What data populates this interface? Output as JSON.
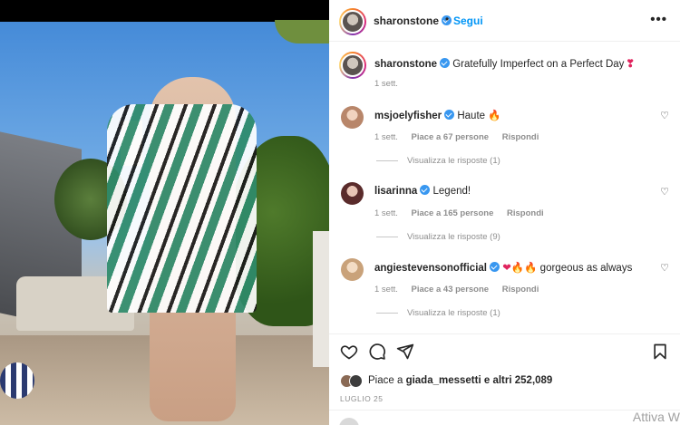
{
  "header": {
    "username": "sharonstone",
    "separator": "•",
    "follow_label": "Segui",
    "more_label": "•••"
  },
  "caption": {
    "username": "sharonstone",
    "text": "Gratefully Imperfect on a Perfect Day",
    "emoji": "❣",
    "time": "1 sett."
  },
  "comments": [
    {
      "username": "msjoelyfisher",
      "text": "Haute",
      "emoji": "🔥",
      "time": "1 sett.",
      "likes": "Piace a 67 persone",
      "reply_label": "Rispondi",
      "view_replies": "Visualizza le risposte (1)",
      "avatar_color": "#b8866a"
    },
    {
      "username": "lisarinna",
      "text": "Legend!",
      "time": "1 sett.",
      "likes": "Piace a 165 persone",
      "reply_label": "Rispondi",
      "view_replies": "Visualizza le risposte (9)",
      "avatar_color": "#5a2b2b"
    },
    {
      "username": "angiestevensonofficial",
      "emoji": "❤🔥🔥",
      "text": "gorgeous as always",
      "time": "1 sett.",
      "likes": "Piace a 43 persone",
      "reply_label": "Rispondi",
      "view_replies": "Visualizza le risposte (1)",
      "avatar_color": "#c9a27a"
    }
  ],
  "actions": {
    "like_icon": "heart-icon",
    "comment_icon": "comment-icon",
    "share_icon": "paper-plane-icon",
    "save_icon": "bookmark-icon"
  },
  "likes_summary": {
    "prefix": "Piace a",
    "user": "giada_messetti",
    "suffix": "e altri 252,089"
  },
  "date": "LUGLIO 25",
  "watermark": "Attiva W",
  "colors": {
    "link_blue": "#0095f6",
    "verified_blue": "#3897f0",
    "meta_gray": "#8e8e8e"
  }
}
